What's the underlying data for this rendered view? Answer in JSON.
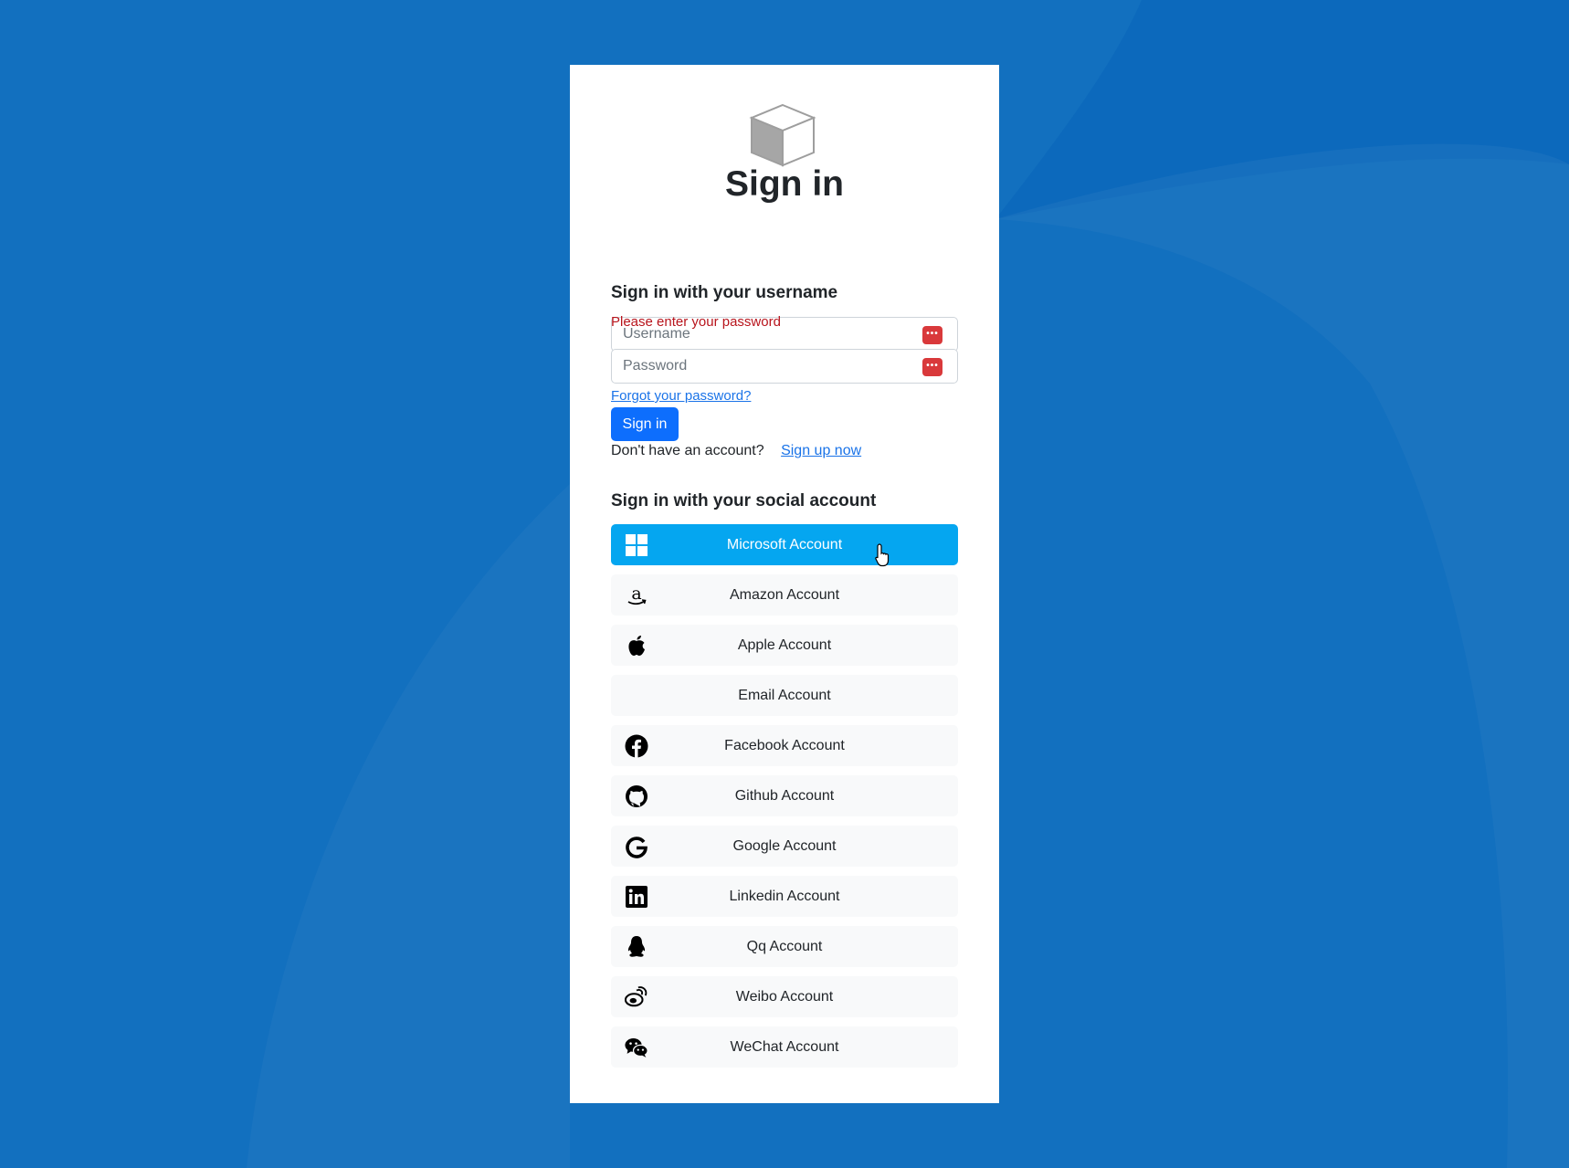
{
  "colors": {
    "background": "#1270bf",
    "primary_button": "#0d6efd",
    "microsoft_button": "#05a6f0",
    "error_text": "#b8141c",
    "link": "#1a73e8"
  },
  "header": {
    "logo_icon": "cube-icon",
    "title": "Sign in"
  },
  "local_account": {
    "heading": "Sign in with your username",
    "username": {
      "value": "",
      "placeholder": "Username"
    },
    "password_error": "Please enter your password",
    "password": {
      "value": "",
      "placeholder": "Password"
    },
    "forgot_password": "Forgot your password?",
    "signin_button": "Sign in",
    "no_account_text": "Don't have an account?",
    "signup_link": "Sign up now"
  },
  "social": {
    "heading": "Sign in with your social account",
    "providers": [
      {
        "label": "Microsoft Account",
        "icon": "windows-icon"
      },
      {
        "label": "Amazon Account",
        "icon": "amazon-icon"
      },
      {
        "label": "Apple Account",
        "icon": "apple-icon"
      },
      {
        "label": "Email Account",
        "icon": ""
      },
      {
        "label": "Facebook Account",
        "icon": "facebook-icon"
      },
      {
        "label": "Github Account",
        "icon": "github-icon"
      },
      {
        "label": "Google Account",
        "icon": "google-icon"
      },
      {
        "label": "Linkedin Account",
        "icon": "linkedin-icon"
      },
      {
        "label": "Qq Account",
        "icon": "qq-icon"
      },
      {
        "label": "Weibo Account",
        "icon": "weibo-icon"
      },
      {
        "label": "WeChat Account",
        "icon": "wechat-icon"
      }
    ]
  }
}
